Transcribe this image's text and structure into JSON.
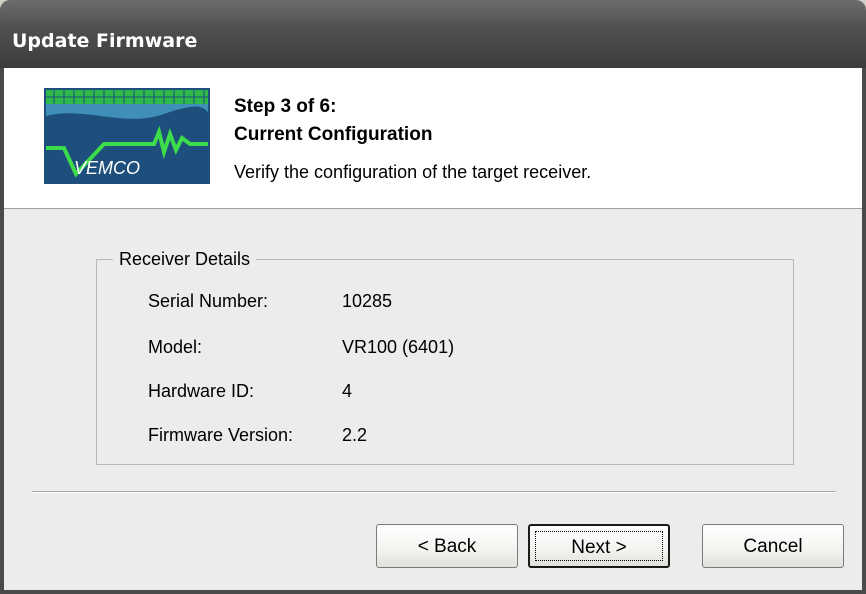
{
  "window": {
    "title": "Update Firmware"
  },
  "header": {
    "step": "Step 3 of 6:",
    "title": "Current Configuration",
    "description": "Verify the configuration of the target receiver.",
    "logo_text": "VEMCO"
  },
  "details": {
    "legend": "Receiver Details",
    "rows": [
      {
        "label": "Serial Number:",
        "value": "10285"
      },
      {
        "label": "Model:",
        "value": "VR100 (6401)"
      },
      {
        "label": "Hardware ID:",
        "value": "4"
      },
      {
        "label": "Firmware Version:",
        "value": "2.2"
      }
    ]
  },
  "buttons": {
    "back": "< Back",
    "next": "Next >",
    "cancel": "Cancel"
  },
  "colors": {
    "logo_background": "#1b4f72",
    "logo_green": "#2ecc40",
    "titlebar": "#4e4e4e",
    "panel": "#ececec"
  }
}
